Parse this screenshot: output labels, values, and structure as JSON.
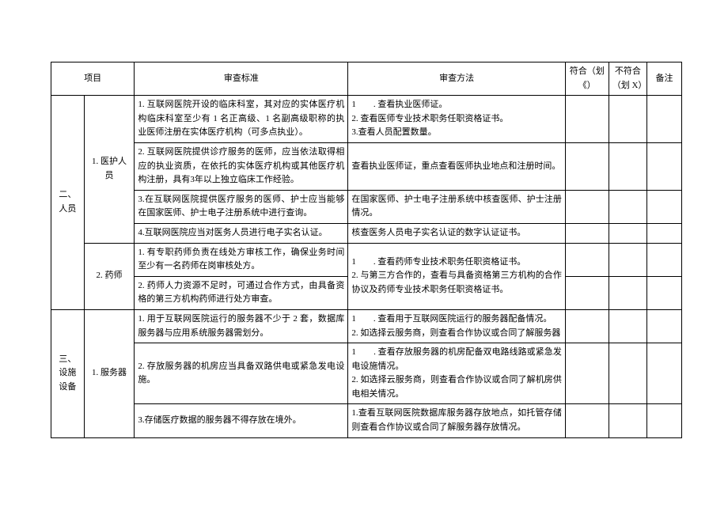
{
  "headers": {
    "project": "项目",
    "standard": "审查标准",
    "method": "审查方法",
    "pass": "符合（划《）",
    "fail": "不符合（划 X）",
    "note": "备注"
  },
  "sections": [
    {
      "cat": "二、人员",
      "groups": [
        {
          "sub": "1. 医护人员",
          "rows": [
            {
              "std": "1. 互联网医院开设的临床科室，其对应的实体医疗机构临床科室至少有 1 名正高级、1 名副高级职称的执业医师注册在实体医疗机构（可多点执业）。",
              "mtd": "1　　. 查看执业医师证。\n2. 查看医师专业技术职务任职资格证书。\n3.查看人员配置数量。"
            },
            {
              "std": "2. 互联网医院提供诊疗服务的医师，应当依法取得相应的执业资质，在依托的实体医疗机构或其他医疗机构注册，具有3年以上独立临床工作经验。",
              "mtd": "查看执业医师证，重点查看医师执业地点和注册时间。"
            },
            {
              "std": "3.在互联网医院提供医疗服务的医师、护士应当能够在国家医师、护士电子注册系统中进行查询。",
              "mtd": "在国家医师、护士电子注册系统中核查医师、护士注册情况。"
            },
            {
              "std": "4.互联网医院应当对医务人员进行电子实名认证。",
              "mtd": "核查医务人员电子实名认证的数字认证证书。"
            }
          ]
        },
        {
          "sub": "2. 药师",
          "rows": [
            {
              "std": "1. 有专职药师负责在线处方审核工作，确保业务时间至少有一名药师在岗审核处方。",
              "mtd_merged": "1　　. 查看药师专业技术职务任职资格证书。\n2. 与第三方合作的，查看与具备资格第三方机构的合作协议及药师专业技术职务任职资格证书。"
            },
            {
              "std": "2. 药师人力资源不足时，可通过合作方式，由具备资格的第三方机构药师进行处方审查。"
            }
          ]
        }
      ]
    },
    {
      "cat": "三、设施设备",
      "groups": [
        {
          "sub": "1. 服务器",
          "rows": [
            {
              "std": "1. 用于互联网医院运行的服务器不少于 2 套，数据库服务器与应用系统服务器需划分。",
              "mtd": "1　　. 查看用于互联网医院运行的服务器配备情况。\n2. 如选择云服务商，则查看合作协议或合同了解服务器"
            },
            {
              "std": "2. 存放服务器的机房应当具备双路供电或紧急发电设施。",
              "mtd": "1　　. 查看存放服务器的机房配备双电路线路或紧急发电设施情况。\n2. 如选择云服务商，则查看合作协议或合同了解机房供电相关情况。"
            },
            {
              "std": "3.存储医疗数据的服务器不得存放在境外。",
              "mtd": "1.查看互联网医院数据库服务器存放地点，如托管存储则查看合作协议或合同了解服务器存放情况。"
            }
          ]
        }
      ]
    }
  ]
}
